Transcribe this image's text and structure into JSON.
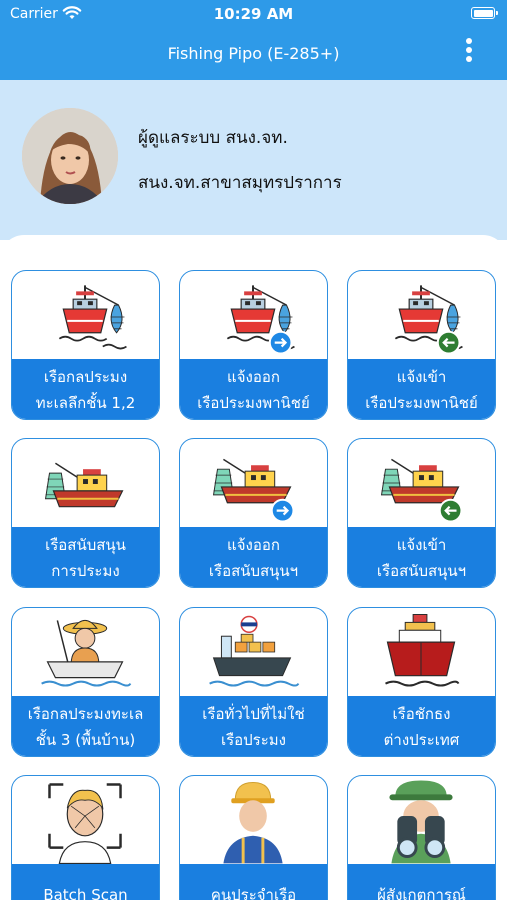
{
  "status_bar": {
    "carrier": "Carrier",
    "time": "10:29 AM"
  },
  "app_bar": {
    "title": "Fishing Pipo (E-285+)"
  },
  "profile": {
    "name": "ผู้ดูแลระบบ สนง.จท.",
    "organization": "สนง.จท.สาขาสมุทรปราการ"
  },
  "menu": [
    {
      "line1": "เรือกลประมง",
      "line2": "ทะเลลึกชั้น 1,2"
    },
    {
      "line1": "แจ้งออก",
      "line2": "เรือประมงพานิชย์"
    },
    {
      "line1": "แจ้งเข้า",
      "line2": "เรือประมงพานิชย์"
    },
    {
      "line1": "เรือสนับสนุน",
      "line2": "การประมง"
    },
    {
      "line1": "แจ้งออก",
      "line2": "เรือสนับสนุนฯ"
    },
    {
      "line1": "แจ้งเข้า",
      "line2": "เรือสนับสนุนฯ"
    },
    {
      "line1": "เรือกลประมงทะเล",
      "line2": "ชั้น 3 (พื้นบ้าน)"
    },
    {
      "line1": "เรือทั่วไปที่ไม่ใช่",
      "line2": "เรือประมง"
    },
    {
      "line1": "เรือชักธง",
      "line2": "ต่างประเทศ"
    },
    {
      "line1": "Batch Scan",
      "line2": ""
    },
    {
      "line1": "คนประจำเรือ",
      "line2": ""
    },
    {
      "line1": "ผู้สังเกตการณ์",
      "line2": ""
    }
  ],
  "colors": {
    "header": "#2e9ae8",
    "profile_bg": "#cde6fa",
    "card_label": "#1a7fe0",
    "card_border": "#2e8fe0",
    "arrow_out": "#1e88e5",
    "arrow_in": "#2e7d32"
  }
}
